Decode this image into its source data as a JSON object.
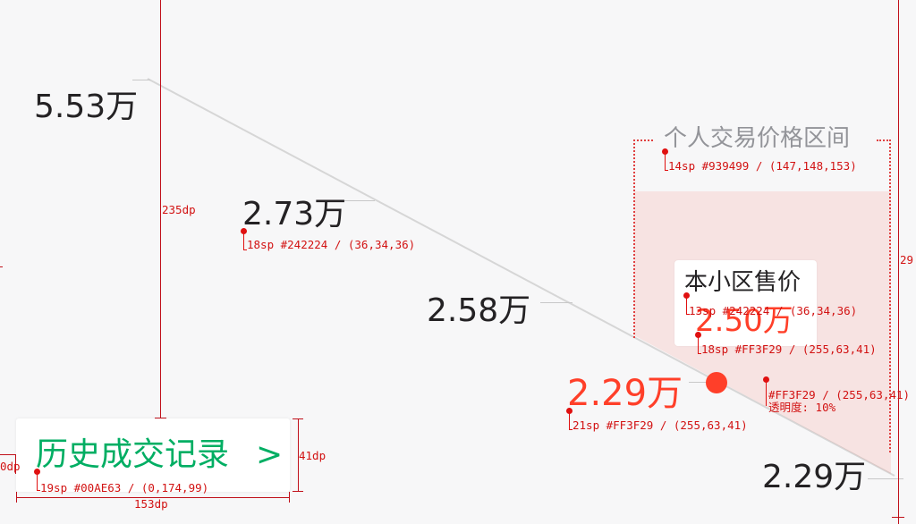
{
  "chart": {
    "price_max": "5.53万",
    "price_mid_high": "2.73万",
    "price_mid": "2.58万",
    "price_min": "2.29万",
    "current_price": "2.29万"
  },
  "personal_range": {
    "title": "个人交易价格区间",
    "title_spec": "14sp #939499 / (147,148,153)",
    "fill_spec": "#FF3F29 / (255,63,41)",
    "fill_opacity_spec": "透明度: 10%"
  },
  "community": {
    "title": "本小区售价",
    "title_spec": "13sp #242224 / (36,34,36)",
    "price": "2.50万",
    "price_spec": "18sp #FF3F29 / (255,63,41)"
  },
  "specs": {
    "label_spec": "18sp #242224 / (36,34,36)",
    "current_price_spec": "21sp #FF3F29 / (255,63,41)",
    "history_spec": "19sp #00AE63 / (0,174,99)"
  },
  "history": {
    "label": "历史成交记录",
    "chevron": ">"
  },
  "dimensions": {
    "chart_height": "235dp",
    "button_height": "41dp",
    "button_width": "153dp",
    "left_margin": "0dp",
    "range_height": "29"
  },
  "colors": {
    "accent_red": "#FF3F29",
    "text_dark": "#242224",
    "text_gray": "#939499",
    "green": "#00AE63"
  }
}
